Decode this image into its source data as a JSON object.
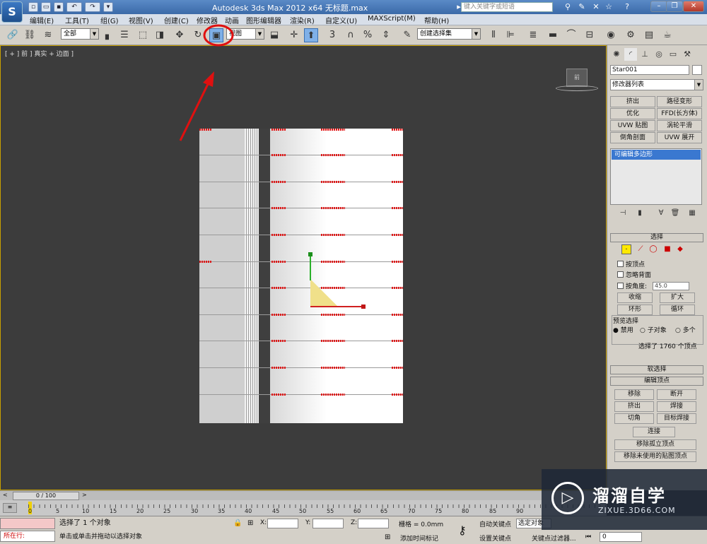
{
  "window": {
    "title": "Autodesk 3ds Max  2012 x64     无标题.max",
    "search_placeholder": "键入关键字或短语",
    "logo": "S",
    "min": "–",
    "restore": "❐",
    "close": "✕"
  },
  "menu": [
    "编辑(E)",
    "工具(T)",
    "组(G)",
    "视图(V)",
    "创建(C)",
    "修改器",
    "动画",
    "图形编辑器",
    "渲染(R)",
    "自定义(U)",
    "MAXScript(M)",
    "帮助(H)"
  ],
  "toolbar": {
    "selection_filter": "全部",
    "ref_coord": "视图",
    "named_selection": "创建选择集"
  },
  "viewport": {
    "label": "[ + ] 前 ] 真实 + 边面 ]",
    "viewcube_label": "前"
  },
  "command_panel": {
    "object_name": "Star001",
    "modifier_list": "修改器列表",
    "modifier_buttons": [
      "挤出",
      "路径变形",
      "优化",
      "FFD(长方体)",
      "UVW 贴图",
      "涡轮平滑",
      "倒角剖面",
      "UVW 展开"
    ],
    "stack_item": "可编辑多边形",
    "selection_header": "选择",
    "by_vertex": "按顶点",
    "ignore_backfacing": "忽略背面",
    "by_angle": "按角度:",
    "angle_value": "45.0",
    "shrink": "收缩",
    "grow": "扩大",
    "ring": "环形",
    "loop": "循环",
    "preview_selection": "预览选择",
    "preview_options": [
      "禁用",
      "子对象",
      "多个"
    ],
    "selected_count": "选择了 1760 个顶点",
    "soft_selection": "软选择",
    "edit_vertices": "编辑顶点",
    "remove": "移除",
    "break": "断开",
    "extrude": "挤出",
    "weld": "焊接",
    "chamfer": "切角",
    "target_weld": "目标焊接",
    "connect": "连接",
    "remove_isolated": "移除孤立顶点",
    "remove_unused_map": "移除未使用的贴图顶点"
  },
  "time": {
    "slider": "0 / 100",
    "ticks": [
      "0",
      "5",
      "10",
      "15",
      "20",
      "25",
      "30",
      "35",
      "40",
      "45",
      "50",
      "55",
      "60",
      "65",
      "70",
      "75",
      "80",
      "85",
      "90"
    ]
  },
  "status": {
    "listener": "所在行:",
    "message": "选择了 1 个对象",
    "prompt": "单击或单击并拖动以选择对象",
    "x_label": "X:",
    "y_label": "Y:",
    "z_label": "Z:",
    "grid": "栅格 = 0.0mm",
    "add_time_tag": "添加时间标记",
    "auto_key": "自动关键点",
    "set_key": "设置关键点",
    "selected_dropdown": "选定对象",
    "key_filters": "关键点过滤器...",
    "frame": "0"
  },
  "watermark": {
    "logo": "▷",
    "title": "溜溜自学",
    "url": "ZIXUE.3D66.COM"
  },
  "colors": {
    "accent": "#3a78d0",
    "annotation": "#e01010",
    "viewport_border": "#c8a000"
  }
}
